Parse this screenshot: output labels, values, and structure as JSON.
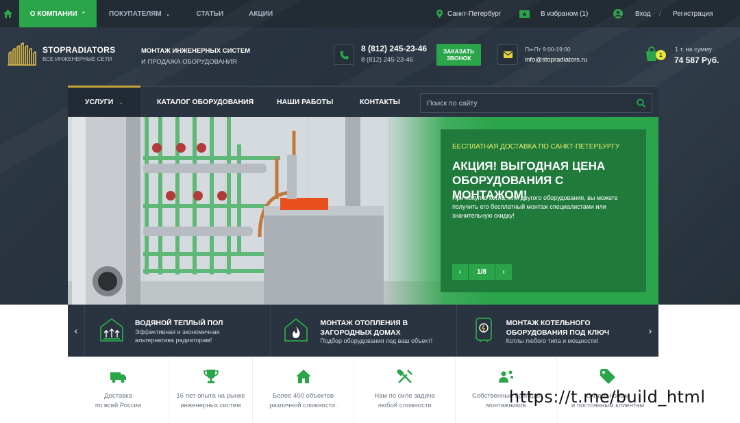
{
  "topbar": {
    "nav": [
      {
        "label": "О КОМПАНИИ"
      },
      {
        "label": "ПОКУПАТЕЛЯМ"
      },
      {
        "label": "СТАТЬИ"
      },
      {
        "label": "АКЦИИ"
      }
    ],
    "city": "Санкт-Петербург",
    "favorites": "В избраном (1)",
    "login": "Вход",
    "separator": "/",
    "register": "Регистрация"
  },
  "header": {
    "logo_title": "STOPRADIATORS",
    "logo_sub": "ВСЕ ИНЖЕНЕРНЫЕ СЕТИ",
    "tagline_1": "МОНТАЖ ИНЖЕНЕРНЫХ СИСТЕМ",
    "tagline_2": "И ПРОДАЖА ОБОРУДОВАНИЯ",
    "phone_main": "8 (812) 245-23-46",
    "phone_secondary": "8 (812) 245-23-46",
    "callback_button": "ЗАКАЗАТЬ ЗВОНОК",
    "hours": "Пн-Пт 9:00-19:00",
    "email": "info@stopradiators.ru",
    "cart_count": "1",
    "cart_label": "1 т. на сумму",
    "cart_sum": "74 587 Руб."
  },
  "navbar": {
    "items": [
      {
        "label": "УСЛУГИ"
      },
      {
        "label": "КАТАЛОГ ОБОРУДОВАНИЯ"
      },
      {
        "label": "НАШИ РАБОТЫ"
      },
      {
        "label": "КОНТАКТЫ"
      }
    ],
    "search_placeholder": "Поиск по сайту"
  },
  "hero": {
    "subtitle": "БЕСПЛАТНАЯ ДОСТАВКА ПО САНКТ-ПЕТЕРБУРГУ",
    "title": "АКЦИЯ! ВЫГОДНАЯ ЦЕНА ОБОРУДОВАНИЯ С МОНТАЖОМ!",
    "text": "При покупке котла, или другого оборудования, вы можете получить его бесплатный монтаж специалистами или значительную скидку!",
    "counter": "1/8"
  },
  "services": [
    {
      "title": "ВОДЯНОЙ ТЕПЛЫЙ ПОЛ",
      "desc": "Эффективная и экономичная альтернатива радиаторам!",
      "icon": "floor-heating-icon"
    },
    {
      "title": "МОНТАЖ ОТОПЛЕНИЯ В ЗАГОРОДНЫХ ДОМАХ",
      "desc": "Подбор оборудования под ваш объект!",
      "icon": "house-fire-icon"
    },
    {
      "title": "МОНТАЖ КОТЕЛЬНОГО ОБОРУДОВАНИЯ ПОД КЛЮЧ",
      "desc": "Котлы любого типа и мощности!",
      "icon": "boiler-icon"
    }
  ],
  "features": [
    {
      "text": "Доставка\nпо всей России",
      "icon": "truck-icon"
    },
    {
      "text": "16 лет опыта на рынке\nинженерных систем",
      "icon": "trophy-icon"
    },
    {
      "text": "Более 400 объектов\nразличной сложности.",
      "icon": "home-icon"
    },
    {
      "text": "Нам по силе задача\nлюбой сложности",
      "icon": "tools-icon"
    },
    {
      "text": "Собственные бригады\nмонтажников",
      "icon": "workers-icon"
    },
    {
      "text": "Скидки новым\nи постоянным клиентам",
      "icon": "tag-icon"
    }
  ],
  "watermark": "https://t.me/build_html",
  "colors": {
    "green": "#2aa54a",
    "dark": "#232b35",
    "accent_yellow": "#e8f26a",
    "orange": "#e8501f"
  }
}
